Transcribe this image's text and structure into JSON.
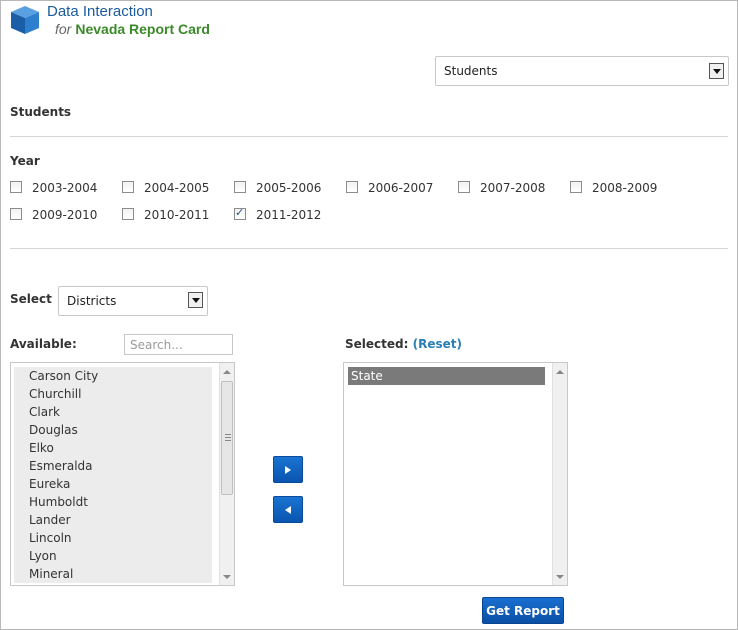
{
  "header": {
    "title": "Data Interaction",
    "subtitle_prefix": "for",
    "subtitle": "Nevada Report Card"
  },
  "report_type": {
    "selected": "Students"
  },
  "section_title": "Students",
  "year": {
    "label": "Year",
    "options": [
      {
        "label": "2003-2004",
        "checked": false
      },
      {
        "label": "2004-2005",
        "checked": false
      },
      {
        "label": "2005-2006",
        "checked": false
      },
      {
        "label": "2006-2007",
        "checked": false
      },
      {
        "label": "2007-2008",
        "checked": false
      },
      {
        "label": "2008-2009",
        "checked": false
      },
      {
        "label": "2009-2010",
        "checked": false
      },
      {
        "label": "2010-2011",
        "checked": false
      },
      {
        "label": "2011-2012",
        "checked": true
      }
    ]
  },
  "select_level": {
    "label": "Select",
    "selected": "Districts"
  },
  "available": {
    "label": "Available:",
    "search_placeholder": "Search...",
    "items": [
      "Carson City",
      "Churchill",
      "Clark",
      "Douglas",
      "Elko",
      "Esmeralda",
      "Eureka",
      "Humboldt",
      "Lander",
      "Lincoln",
      "Lyon",
      "Mineral"
    ]
  },
  "selected": {
    "label": "Selected:",
    "reset_label": "(Reset)",
    "items": [
      "State"
    ]
  },
  "buttons": {
    "add_icon": "triangle-right-icon",
    "remove_icon": "triangle-left-icon",
    "get_report": "Get Report"
  },
  "colors": {
    "brand_blue": "#1b5b9e",
    "brand_green": "#3b8a2a",
    "button_blue": "#0a55b0",
    "link": "#2a7fb4"
  }
}
